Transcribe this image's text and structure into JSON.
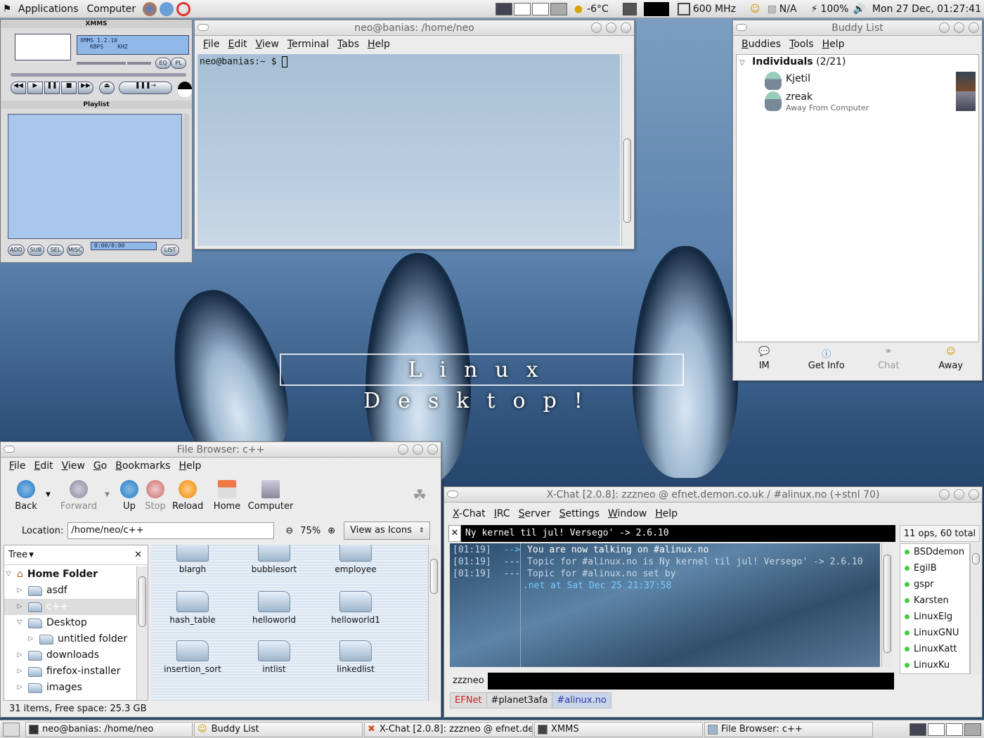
{
  "top_panel": {
    "menus": [
      "Applications",
      "Computer"
    ],
    "weather": "-6°C",
    "cpu_freq": "600 MHz",
    "network": "N/A",
    "battery": "100%",
    "clock": "Mon 27 Dec, 01:27:41"
  },
  "xmms": {
    "title": "XMMS",
    "display": "XMMS 1.2.10",
    "kbps": "KBPS",
    "khz": "KHZ",
    "eq": "EQ",
    "pl": "PL",
    "playlist_title": "Playlist",
    "time": "0:00/0:00",
    "buttons": [
      "ADD",
      "SUB",
      "SEL",
      "MISC",
      "LIST"
    ]
  },
  "terminal": {
    "title": "neo@banias: /home/neo",
    "menus": [
      "File",
      "Edit",
      "View",
      "Terminal",
      "Tabs",
      "Help"
    ],
    "prompt": "neo@banias:~ $ "
  },
  "buddy": {
    "title": "Buddy List",
    "menus": [
      "Buddies",
      "Tools",
      "Help"
    ],
    "group": "Individuals",
    "group_count": "(2/21)",
    "buddies": [
      {
        "name": "Kjetil",
        "status": ""
      },
      {
        "name": "zreak",
        "status": "Away From Computer"
      }
    ],
    "actions": [
      "IM",
      "Get Info",
      "Chat",
      "Away"
    ]
  },
  "wallpaper_text": "Linux Desktop!",
  "filebrowser": {
    "title": "File Browser: c++",
    "menus": [
      "File",
      "Edit",
      "View",
      "Go",
      "Bookmarks",
      "Help"
    ],
    "toolbar": [
      "Back",
      "Forward",
      "Up",
      "Stop",
      "Reload",
      "Home",
      "Computer"
    ],
    "location_label": "Location:",
    "location": "/home/neo/c++",
    "zoom": "75%",
    "view_as": "View as Icons",
    "sidebar_mode": "Tree",
    "tree": [
      {
        "label": "Home Folder",
        "level": 0,
        "expanded": true
      },
      {
        "label": "asdf",
        "level": 1
      },
      {
        "label": "c++",
        "level": 1,
        "selected": true
      },
      {
        "label": "Desktop",
        "level": 1,
        "expanded": true
      },
      {
        "label": "untitled folder",
        "level": 2
      },
      {
        "label": "downloads",
        "level": 1
      },
      {
        "label": "firefox-installer",
        "level": 1
      },
      {
        "label": "images",
        "level": 1
      }
    ],
    "files": [
      "blargh",
      "bubblesort",
      "employee",
      "hash_table",
      "helloworld",
      "helloworld1",
      "insertion_sort",
      "intlist",
      "linkedlist"
    ],
    "status": "31 items, Free space: 25.3 GB"
  },
  "xchat": {
    "title": "X-Chat [2.0.8]: zzzneo @ efnet.demon.co.uk / #alinux.no (+stnl 70)",
    "menus": [
      "X-Chat",
      "IRC",
      "Server",
      "Settings",
      "Window",
      "Help"
    ],
    "topic": "Ny kernel til jul! Versego' -> 2.6.10",
    "ops": "11 ops, 60 total",
    "lines": [
      {
        "time": "[01:19]",
        "tag": "-->",
        "text": "You are now talking on #alinux.no"
      },
      {
        "time": "[01:19]",
        "tag": "---",
        "text": "Topic for #alinux.no is Ny kernel til jul! Versego' -> 2.6.10"
      },
      {
        "time": "[01:19]",
        "tag": "---",
        "text": "Topic for #alinux.no set by"
      },
      {
        "time": "",
        "tag": "",
        "text": ".net at Sat Dec 25 21:37:58"
      }
    ],
    "nicks": [
      "BSDdemon",
      "EgilB",
      "gspr",
      "Karsten",
      "LinuxElg",
      "LinuxGNU",
      "LinuxKatt",
      "LinuxKu"
    ],
    "my_nick": "zzzneo",
    "tabs": [
      "EFNet",
      "#planet3afa",
      "#alinux.no"
    ]
  },
  "taskbar": [
    "neo@banias: /home/neo",
    "Buddy List",
    "X-Chat [2.0.8]: zzzneo @ efnet.de",
    "XMMS",
    "File Browser: c++"
  ]
}
